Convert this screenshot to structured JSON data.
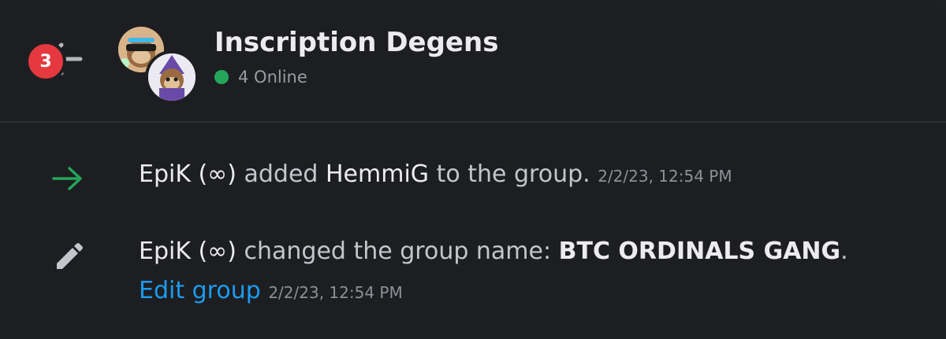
{
  "header": {
    "notification_count": "3",
    "title": "Inscription Degens",
    "online_text": "4 Online"
  },
  "messages": [
    {
      "icon": "arrow-right-icon",
      "actor": "EpiK (∞)",
      "verb": " added ",
      "target": "HemmiG",
      "rest": " to the group.",
      "timestamp": "2/2/23, 12:54 PM"
    },
    {
      "icon": "pencil-icon",
      "actor": "EpiK (∞)",
      "verb": " changed the group name: ",
      "new_name": "BTC ORDINALS GANG",
      "rest": ".",
      "link": "Edit group",
      "timestamp": "2/2/23, 12:54 PM"
    }
  ],
  "colors": {
    "background": "#1d1e21",
    "badge": "#e5393f",
    "online": "#23a55a",
    "join_arrow": "#23a55a",
    "link": "#1d9bf0"
  }
}
